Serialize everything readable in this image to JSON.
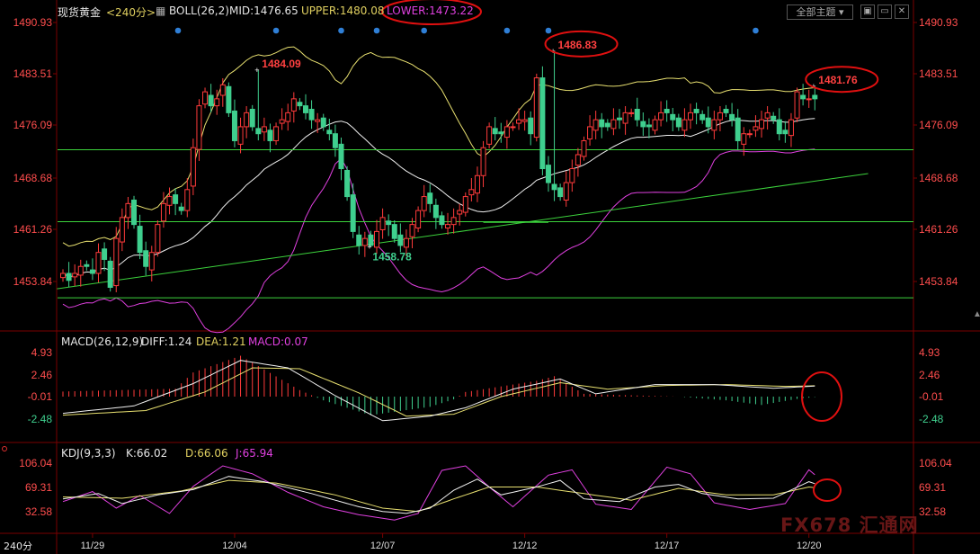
{
  "header": {
    "symbol": "现货黄金",
    "period": "<240分>",
    "boll_label": "BOLL(26,2)",
    "mid": "MID:1476.65",
    "upper": "UPPER:1480.08",
    "lower": "LOWER:1473.22",
    "theme_button": "全部主题",
    "win_buttons": [
      "▣",
      "▭",
      "✕"
    ]
  },
  "macd_header": {
    "label": "MACD(26,12,9)",
    "diff": "DIFF:1.24",
    "dea": "DEA:1.21",
    "macd": "MACD:0.07"
  },
  "kdj_header": {
    "label": "KDJ(9,3,3)",
    "k": "K:66.02",
    "d": "D:66.06",
    "j": "J:65.94"
  },
  "period_footer": "240分",
  "watermark": "FX678 汇通网",
  "colors": {
    "up": "#ff3b3b",
    "down": "#3fcf8e",
    "boll": "#e8e070",
    "lower": "#e040e0",
    "trend": "#3cd23c",
    "annot": "#e01010"
  },
  "chart_data": {
    "type": "candlestick",
    "price_axis": {
      "ticks": [
        "1490.93",
        "1483.51",
        "1476.09",
        "1468.68",
        "1461.26",
        "1453.84"
      ]
    },
    "macd_axis": {
      "ticks": [
        "4.93",
        "2.46",
        "-0.01",
        "-2.48"
      ]
    },
    "kdj_axis": {
      "ticks": [
        "106.04",
        "69.31",
        "32.58"
      ]
    },
    "date_labels": [
      {
        "i": 5,
        "text": "11/29"
      },
      {
        "i": 29,
        "text": "12/04"
      },
      {
        "i": 54,
        "text": "12/07"
      },
      {
        "i": 78,
        "text": "12/12"
      },
      {
        "i": 102,
        "text": "12/17"
      },
      {
        "i": 126,
        "text": "12/20"
      }
    ],
    "annotations": [
      {
        "i": 33,
        "price": 1484.09,
        "text": "1484.09",
        "type": "high",
        "color": "#ff4040"
      },
      {
        "i": 83,
        "price": 1486.83,
        "text": "1486.83",
        "type": "high",
        "color": "#ff4040",
        "circled": true
      },
      {
        "i": 127,
        "price": 1481.76,
        "text": "1481.76",
        "type": "high",
        "color": "#ff4040",
        "circled": true
      },
      {
        "i": 52,
        "price": 1458.78,
        "text": "1458.78",
        "type": "low",
        "color": "#3fcf8e"
      }
    ],
    "event_dot_indices": [
      0,
      36,
      47,
      53,
      61,
      75,
      82,
      117
    ],
    "horizontal_levels": [
      1472.7,
      1462.4,
      1451.5
    ],
    "trendlines": [
      {
        "from": {
          "i": -1,
          "price": 1452.8
        },
        "to": {
          "i": 136,
          "price": 1469.3
        }
      },
      {
        "from": {
          "i": 71,
          "price": 1462.3
        },
        "to": {
          "i": 82,
          "price": 1462.3
        }
      }
    ],
    "candle_keys": [
      1455,
      1454,
      1455,
      1456,
      1456,
      1455,
      1458,
      1457,
      1453,
      1460,
      1463,
      1465,
      1462,
      1458,
      1456,
      1458,
      1462,
      1465,
      1466,
      1465,
      1464,
      1467,
      1473,
      1479,
      1481,
      1479,
      1480,
      1482,
      1478,
      1474,
      1476,
      1478,
      1476,
      1475,
      1476,
      1474,
      1476,
      1477,
      1478,
      1480,
      1479,
      1478,
      1477,
      1477,
      1476,
      1475,
      1473,
      1470,
      1466,
      1461,
      1459,
      1460,
      1459,
      1461,
      1463,
      1462,
      1460,
      1459,
      1460,
      1462,
      1464,
      1466,
      1465,
      1463,
      1462,
      1462,
      1463,
      1464,
      1466,
      1467,
      1469,
      1473,
      1476,
      1475,
      1475,
      1476,
      1476,
      1477,
      1477,
      1475,
      1483,
      1470,
      1468,
      1467,
      1466,
      1468,
      1470,
      1472,
      1474,
      1476,
      1477,
      1476,
      1476,
      1477,
      1477,
      1478,
      1478,
      1477,
      1476,
      1476,
      1477,
      1478,
      1478,
      1477,
      1476,
      1477,
      1478,
      1478,
      1477,
      1476,
      1477,
      1478,
      1478,
      1477,
      1474,
      1475,
      1475,
      1476,
      1477,
      1478,
      1477,
      1475,
      1475,
      1477,
      1481,
      1480,
      1480,
      1480
    ],
    "macd_hist_profile": [
      [
        0,
        0.55
      ],
      [
        19,
        0.85
      ],
      [
        22,
        2.6
      ],
      [
        30,
        4.4
      ],
      [
        40,
        0.7
      ],
      [
        44,
        -0.4
      ],
      [
        52,
        -2.0
      ],
      [
        62,
        -1.1
      ],
      [
        66,
        -0.3
      ],
      [
        68,
        0.5
      ],
      [
        80,
        1.7
      ],
      [
        83,
        2.2
      ],
      [
        88,
        0.3
      ],
      [
        93,
        0.2
      ],
      [
        104,
        0.0
      ],
      [
        112,
        -0.4
      ],
      [
        118,
        -0.9
      ],
      [
        124,
        -0.25
      ],
      [
        128,
        0.03
      ],
      [
        130,
        0.07
      ]
    ],
    "diff_profile": [
      [
        0,
        -1.8
      ],
      [
        12,
        -1.0
      ],
      [
        22,
        1.4
      ],
      [
        30,
        3.9
      ],
      [
        38,
        3.1
      ],
      [
        46,
        0.1
      ],
      [
        54,
        -2.6
      ],
      [
        62,
        -2.1
      ],
      [
        68,
        -1.2
      ],
      [
        76,
        0.8
      ],
      [
        84,
        1.9
      ],
      [
        90,
        0.3
      ],
      [
        100,
        1.3
      ],
      [
        110,
        1.3
      ],
      [
        120,
        0.9
      ],
      [
        130,
        1.24
      ]
    ],
    "dea_profile": [
      [
        0,
        -2.0
      ],
      [
        14,
        -1.5
      ],
      [
        24,
        0.5
      ],
      [
        32,
        3.1
      ],
      [
        40,
        3.0
      ],
      [
        50,
        0.4
      ],
      [
        58,
        -2.1
      ],
      [
        66,
        -1.9
      ],
      [
        74,
        0.0
      ],
      [
        84,
        1.5
      ],
      [
        92,
        0.8
      ],
      [
        102,
        1.2
      ],
      [
        112,
        1.3
      ],
      [
        122,
        1.1
      ],
      [
        130,
        1.21
      ]
    ],
    "kdj_k_profile": [
      [
        0,
        52
      ],
      [
        6,
        60
      ],
      [
        10,
        45
      ],
      [
        16,
        58
      ],
      [
        22,
        66
      ],
      [
        28,
        86
      ],
      [
        34,
        78
      ],
      [
        42,
        60
      ],
      [
        50,
        40
      ],
      [
        54,
        33
      ],
      [
        58,
        30
      ],
      [
        62,
        38
      ],
      [
        66,
        65
      ],
      [
        70,
        82
      ],
      [
        74,
        58
      ],
      [
        80,
        70
      ],
      [
        84,
        80
      ],
      [
        88,
        52
      ],
      [
        94,
        48
      ],
      [
        100,
        70
      ],
      [
        104,
        74
      ],
      [
        108,
        60
      ],
      [
        114,
        52
      ],
      [
        120,
        53
      ],
      [
        126,
        78
      ],
      [
        130,
        66
      ]
    ],
    "kdj_d_profile": [
      [
        0,
        55
      ],
      [
        10,
        53
      ],
      [
        20,
        64
      ],
      [
        28,
        80
      ],
      [
        36,
        76
      ],
      [
        46,
        58
      ],
      [
        54,
        38
      ],
      [
        60,
        33
      ],
      [
        66,
        52
      ],
      [
        72,
        70
      ],
      [
        80,
        70
      ],
      [
        88,
        60
      ],
      [
        96,
        50
      ],
      [
        104,
        68
      ],
      [
        112,
        58
      ],
      [
        120,
        58
      ],
      [
        126,
        70
      ],
      [
        130,
        66
      ]
    ],
    "kdj_j_profile": [
      [
        0,
        48
      ],
      [
        5,
        63
      ],
      [
        9,
        38
      ],
      [
        13,
        57
      ],
      [
        18,
        30
      ],
      [
        22,
        71
      ],
      [
        27,
        102
      ],
      [
        32,
        90
      ],
      [
        38,
        62
      ],
      [
        44,
        40
      ],
      [
        50,
        28
      ],
      [
        56,
        20
      ],
      [
        60,
        30
      ],
      [
        64,
        95
      ],
      [
        68,
        102
      ],
      [
        72,
        70
      ],
      [
        76,
        40
      ],
      [
        82,
        88
      ],
      [
        86,
        96
      ],
      [
        90,
        44
      ],
      [
        96,
        36
      ],
      [
        102,
        100
      ],
      [
        106,
        90
      ],
      [
        110,
        46
      ],
      [
        116,
        36
      ],
      [
        122,
        45
      ],
      [
        126,
        96
      ],
      [
        130,
        66
      ]
    ]
  }
}
